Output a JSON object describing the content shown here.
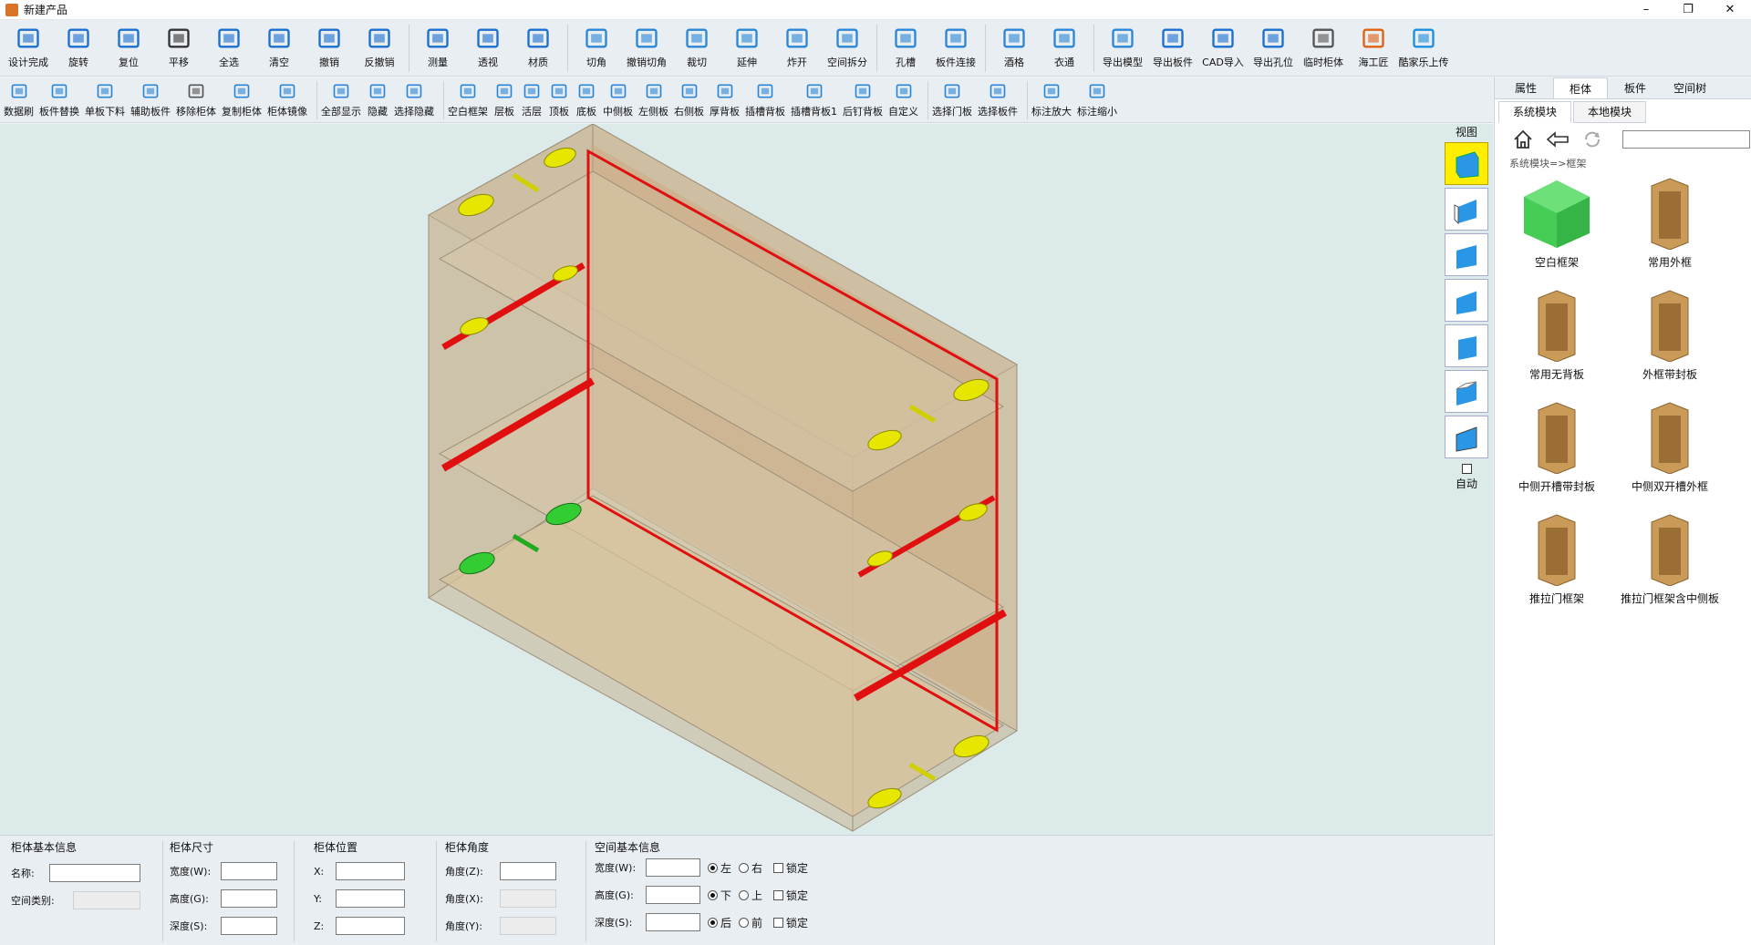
{
  "window": {
    "title": "新建产品",
    "controls": [
      "–",
      "❐",
      "✕"
    ]
  },
  "toolbar1": [
    {
      "id": "design-done",
      "label": "设计完成",
      "icon": "save-icon"
    },
    {
      "id": "rotate",
      "label": "旋转",
      "icon": "rotate-icon"
    },
    {
      "id": "reset",
      "label": "复位",
      "icon": "reset-icon"
    },
    {
      "id": "pan",
      "label": "平移",
      "icon": "hand-icon"
    },
    {
      "id": "select-all",
      "label": "全选",
      "icon": "select-all-icon"
    },
    {
      "id": "clear",
      "label": "清空",
      "icon": "trash-icon"
    },
    {
      "id": "undo",
      "label": "撤销",
      "icon": "undo-icon"
    },
    {
      "id": "redo",
      "label": "反撤销",
      "icon": "redo-icon"
    },
    {
      "id": "sep1",
      "sep": true
    },
    {
      "id": "measure",
      "label": "测量",
      "icon": "measure-icon"
    },
    {
      "id": "perspective",
      "label": "透视",
      "icon": "perspective-icon"
    },
    {
      "id": "material",
      "label": "材质",
      "icon": "material-icon"
    },
    {
      "id": "sep2",
      "sep": true
    },
    {
      "id": "cut-corner",
      "label": "切角",
      "icon": "cut-corner-icon"
    },
    {
      "id": "undo-cut",
      "label": "撤销切角",
      "icon": "undo-cut-icon"
    },
    {
      "id": "crop",
      "label": "裁切",
      "icon": "crop-icon"
    },
    {
      "id": "extend",
      "label": "延伸",
      "icon": "extend-icon"
    },
    {
      "id": "explode",
      "label": "炸开",
      "icon": "explode-icon"
    },
    {
      "id": "space-split",
      "label": "空间拆分",
      "icon": "space-split-icon"
    },
    {
      "id": "sep3",
      "sep": true
    },
    {
      "id": "hole",
      "label": "孔槽",
      "icon": "hole-icon"
    },
    {
      "id": "panel-link",
      "label": "板件连接",
      "icon": "link-icon"
    },
    {
      "id": "sep4",
      "sep": true
    },
    {
      "id": "wine-rack",
      "label": "酒格",
      "icon": "wine-rack-icon"
    },
    {
      "id": "hanger",
      "label": "衣通",
      "icon": "hanger-icon"
    },
    {
      "id": "sep5",
      "sep": true
    },
    {
      "id": "export-model",
      "label": "导出模型",
      "icon": "export-model-icon"
    },
    {
      "id": "export-panel",
      "label": "导出板件",
      "icon": "cad-icon"
    },
    {
      "id": "cad-import",
      "label": "CAD导入",
      "icon": "cad-icon"
    },
    {
      "id": "export-holes",
      "label": "导出孔位",
      "icon": "pdf-icon"
    },
    {
      "id": "temp-cabinet",
      "label": "临时柜体",
      "icon": "cabinet-icon"
    },
    {
      "id": "haigongjiang",
      "label": "海工匠",
      "icon": "haigongjiang-icon"
    },
    {
      "id": "kujiale",
      "label": "酷家乐上传",
      "icon": "kujiale-icon"
    }
  ],
  "toolbar2": [
    {
      "id": "brush",
      "label": "数据刷",
      "icon": "brush-icon"
    },
    {
      "id": "replace",
      "label": "板件替换",
      "icon": "replace-icon"
    },
    {
      "id": "single",
      "label": "单板下料",
      "icon": "panel-icon"
    },
    {
      "id": "aux",
      "label": "辅助板件",
      "icon": "panel-icon"
    },
    {
      "id": "move",
      "label": "移除柜体",
      "icon": "cabinet-icon"
    },
    {
      "id": "copy",
      "label": "复制柜体",
      "icon": "copy-icon"
    },
    {
      "id": "mirror",
      "label": "柜体镜像",
      "icon": "mirror-icon"
    },
    {
      "id": "sep1",
      "sep": true
    },
    {
      "id": "show-all",
      "label": "全部显示",
      "icon": "eye-icon"
    },
    {
      "id": "hide",
      "label": "隐藏",
      "icon": "eye-off-icon"
    },
    {
      "id": "select-hide",
      "label": "选择隐藏",
      "icon": "eye-dark-icon"
    },
    {
      "id": "sep2",
      "sep": true
    },
    {
      "id": "empty-frame",
      "label": "空白框架",
      "icon": "frame-icon"
    },
    {
      "id": "shelf",
      "label": "层板",
      "icon": "shelf-icon"
    },
    {
      "id": "active-shelf",
      "label": "活层",
      "icon": "shelf-icon"
    },
    {
      "id": "top",
      "label": "顶板",
      "icon": "top-icon"
    },
    {
      "id": "bottom",
      "label": "底板",
      "icon": "bottom-icon"
    },
    {
      "id": "middle",
      "label": "中侧板",
      "icon": "middle-icon"
    },
    {
      "id": "left",
      "label": "左侧板",
      "icon": "left-icon"
    },
    {
      "id": "right",
      "label": "右侧板",
      "icon": "right-icon"
    },
    {
      "id": "thick-back",
      "label": "厚背板",
      "icon": "back-icon"
    },
    {
      "id": "slot-back",
      "label": "插槽背板",
      "icon": "back-blue-icon"
    },
    {
      "id": "slot-back1",
      "label": "插槽背板1",
      "icon": "back-blue-icon"
    },
    {
      "id": "nail-back",
      "label": "后钉背板",
      "icon": "back-icon"
    },
    {
      "id": "custom",
      "label": "自定义",
      "icon": "custom-icon"
    },
    {
      "id": "sep3",
      "sep": true
    },
    {
      "id": "select-door",
      "label": "选择门板",
      "icon": "cursor-icon"
    },
    {
      "id": "select-panel",
      "label": "选择板件",
      "icon": "cursor-icon"
    },
    {
      "id": "sep4",
      "sep": true
    },
    {
      "id": "zoom-in",
      "label": "标注放大",
      "icon": "zoom-in-icon"
    },
    {
      "id": "zoom-out",
      "label": "标注缩小",
      "icon": "zoom-out-icon"
    }
  ],
  "viewbar": {
    "label": "视图",
    "auto": "自动"
  },
  "rpanel": {
    "tabs": [
      "属性",
      "柜体",
      "板件",
      "空间树"
    ],
    "active_tab": 1,
    "subtabs": [
      "系统模块",
      "本地模块"
    ],
    "breadcrumb": "系统模块=>框架",
    "modules": [
      "空白框架",
      "常用外框",
      "常用无背板",
      "外框带封板",
      "中侧开槽带封板",
      "中侧双开槽外框",
      "推拉门框架",
      "推拉门框架含中侧板"
    ]
  },
  "bottom": {
    "basic": {
      "title": "柜体基本信息",
      "name": "名称:",
      "type": "空间类别:"
    },
    "size": {
      "title": "柜体尺寸",
      "w": "宽度(W):",
      "h": "高度(G):",
      "d": "深度(S):"
    },
    "pos": {
      "title": "柜体位置",
      "x": "X:",
      "y": "Y:",
      "z": "Z:"
    },
    "angle": {
      "title": "柜体角度",
      "z": "角度(Z):",
      "x": "角度(X):",
      "y": "角度(Y):"
    },
    "space": {
      "title": "空间基本信息",
      "w": "宽度(W):",
      "h": "高度(G):",
      "d": "深度(S):",
      "left": "左",
      "right": "右",
      "down": "下",
      "up": "上",
      "back": "后",
      "front": "前",
      "lock": "锁定"
    }
  }
}
